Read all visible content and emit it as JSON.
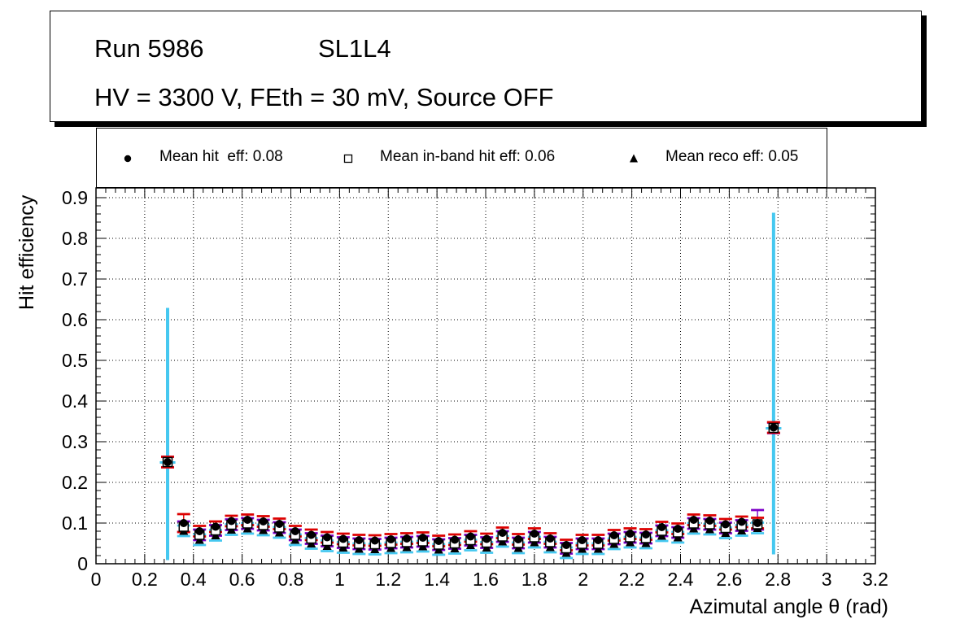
{
  "title_box": {
    "line1_left": "Run 5986",
    "line1_right": "SL1L4",
    "line2": "HV = 3300 V, FEth = 30 mV, Source OFF"
  },
  "legend": {
    "entries": [
      {
        "marker": "filled-circle-icon",
        "label": "Mean hit  eff: 0.08"
      },
      {
        "marker": "open-square-icon",
        "label": "Mean in-band hit eff: 0.06"
      },
      {
        "marker": "filled-triangle-icon",
        "label": "Mean reco eff: 0.05"
      }
    ]
  },
  "axes": {
    "x_title": "Azimutal angle θ (rad)",
    "y_title": "Hit efficiency",
    "x_tick_values": [
      0,
      0.2,
      0.4,
      0.6,
      0.8,
      1,
      1.2,
      1.4,
      1.6,
      1.8,
      2,
      2.2,
      2.4,
      2.6,
      2.8,
      3,
      3.2
    ],
    "x_tick_labels": [
      "0",
      "0.2",
      "0.4",
      "0.6",
      "0.8",
      "1",
      "1.2",
      "1.4",
      "1.6",
      "1.8",
      "2",
      "2.2",
      "2.4",
      "2.6",
      "2.8",
      "3",
      "3.2"
    ],
    "y_tick_values": [
      0,
      0.1,
      0.2,
      0.3,
      0.4,
      0.5,
      0.6,
      0.7,
      0.8,
      0.9
    ],
    "y_tick_labels": [
      "0",
      "0.1",
      "0.2",
      "0.3",
      "0.4",
      "0.5",
      "0.6",
      "0.7",
      "0.8",
      "0.9"
    ]
  },
  "chart_data": {
    "type": "scatter",
    "title": "Run 5986  SL1L4  —  HV = 3300 V, FEth = 30 mV, Source OFF",
    "xlabel": "Azimutal angle θ (rad)",
    "ylabel": "Hit efficiency",
    "xlim": [
      0,
      3.2
    ],
    "ylim": [
      0,
      0.924
    ],
    "grid": "dotted, both axes, black",
    "bin_width": 0.0654,
    "x": [
      0.294,
      0.36,
      0.425,
      0.491,
      0.556,
      0.622,
      0.687,
      0.753,
      0.818,
      0.884,
      0.949,
      1.015,
      1.08,
      1.145,
      1.211,
      1.276,
      1.342,
      1.407,
      1.473,
      1.538,
      1.604,
      1.669,
      1.734,
      1.8,
      1.865,
      1.931,
      1.996,
      2.062,
      2.127,
      2.193,
      2.258,
      2.323,
      2.389,
      2.454,
      2.52,
      2.585,
      2.651,
      2.716,
      2.782
    ],
    "series": [
      {
        "name": "mean-hit-eff",
        "legend_label": "Mean hit  eff: 0.08",
        "mean": 0.08,
        "marker": "filled-circle",
        "marker_color": "#000000",
        "error_color": "#dd0000",
        "default_err": 0.013,
        "err_overrides": {
          "1": [
            0.022,
            0.022
          ]
        },
        "y": [
          0.25,
          0.1,
          0.08,
          0.091,
          0.105,
          0.108,
          0.104,
          0.098,
          0.08,
          0.071,
          0.065,
          0.061,
          0.058,
          0.057,
          0.06,
          0.062,
          0.064,
          0.056,
          0.059,
          0.067,
          0.061,
          0.076,
          0.06,
          0.074,
          0.062,
          0.046,
          0.058,
          0.058,
          0.07,
          0.074,
          0.072,
          0.09,
          0.086,
          0.108,
          0.106,
          0.097,
          0.103,
          0.1,
          0.335
        ]
      },
      {
        "name": "mean-in-band-hit-eff",
        "legend_label": "Mean in-band hit eff: 0.06",
        "mean": 0.06,
        "marker": "open-square",
        "marker_color": "#000000",
        "error_color": "#7d00c8",
        "default_err": 0.013,
        "err_overrides": {
          "37": [
            0.013,
            0.035
          ]
        },
        "y": [
          0.25,
          0.091,
          0.071,
          0.082,
          0.096,
          0.099,
          0.095,
          0.089,
          0.071,
          0.062,
          0.056,
          0.052,
          0.049,
          0.048,
          0.051,
          0.053,
          0.055,
          0.047,
          0.05,
          0.058,
          0.052,
          0.067,
          0.051,
          0.065,
          0.053,
          0.038,
          0.049,
          0.049,
          0.061,
          0.065,
          0.063,
          0.081,
          0.077,
          0.099,
          0.097,
          0.088,
          0.094,
          0.097,
          0.334
        ]
      },
      {
        "name": "mean-reco-eff",
        "legend_label": "Mean reco eff: 0.05",
        "mean": 0.05,
        "marker": "filled-triangle",
        "marker_color": "#000000",
        "error_color": "#45c8f0",
        "default_err": 0.013,
        "err_overrides": {
          "0": [
            0.24,
            0.38
          ],
          "38": [
            0.31,
            0.53
          ]
        },
        "xerr_overrides": {
          "0": 0.032,
          "38": 0.032
        },
        "thick_bar_indices": [
          0,
          38
        ],
        "y": [
          0.249,
          0.081,
          0.059,
          0.07,
          0.084,
          0.087,
          0.083,
          0.077,
          0.059,
          0.05,
          0.044,
          0.04,
          0.037,
          0.036,
          0.039,
          0.041,
          0.043,
          0.035,
          0.038,
          0.046,
          0.04,
          0.055,
          0.039,
          0.053,
          0.041,
          0.027,
          0.037,
          0.037,
          0.049,
          0.053,
          0.051,
          0.069,
          0.065,
          0.087,
          0.085,
          0.076,
          0.082,
          0.088,
          0.333
        ]
      }
    ]
  }
}
